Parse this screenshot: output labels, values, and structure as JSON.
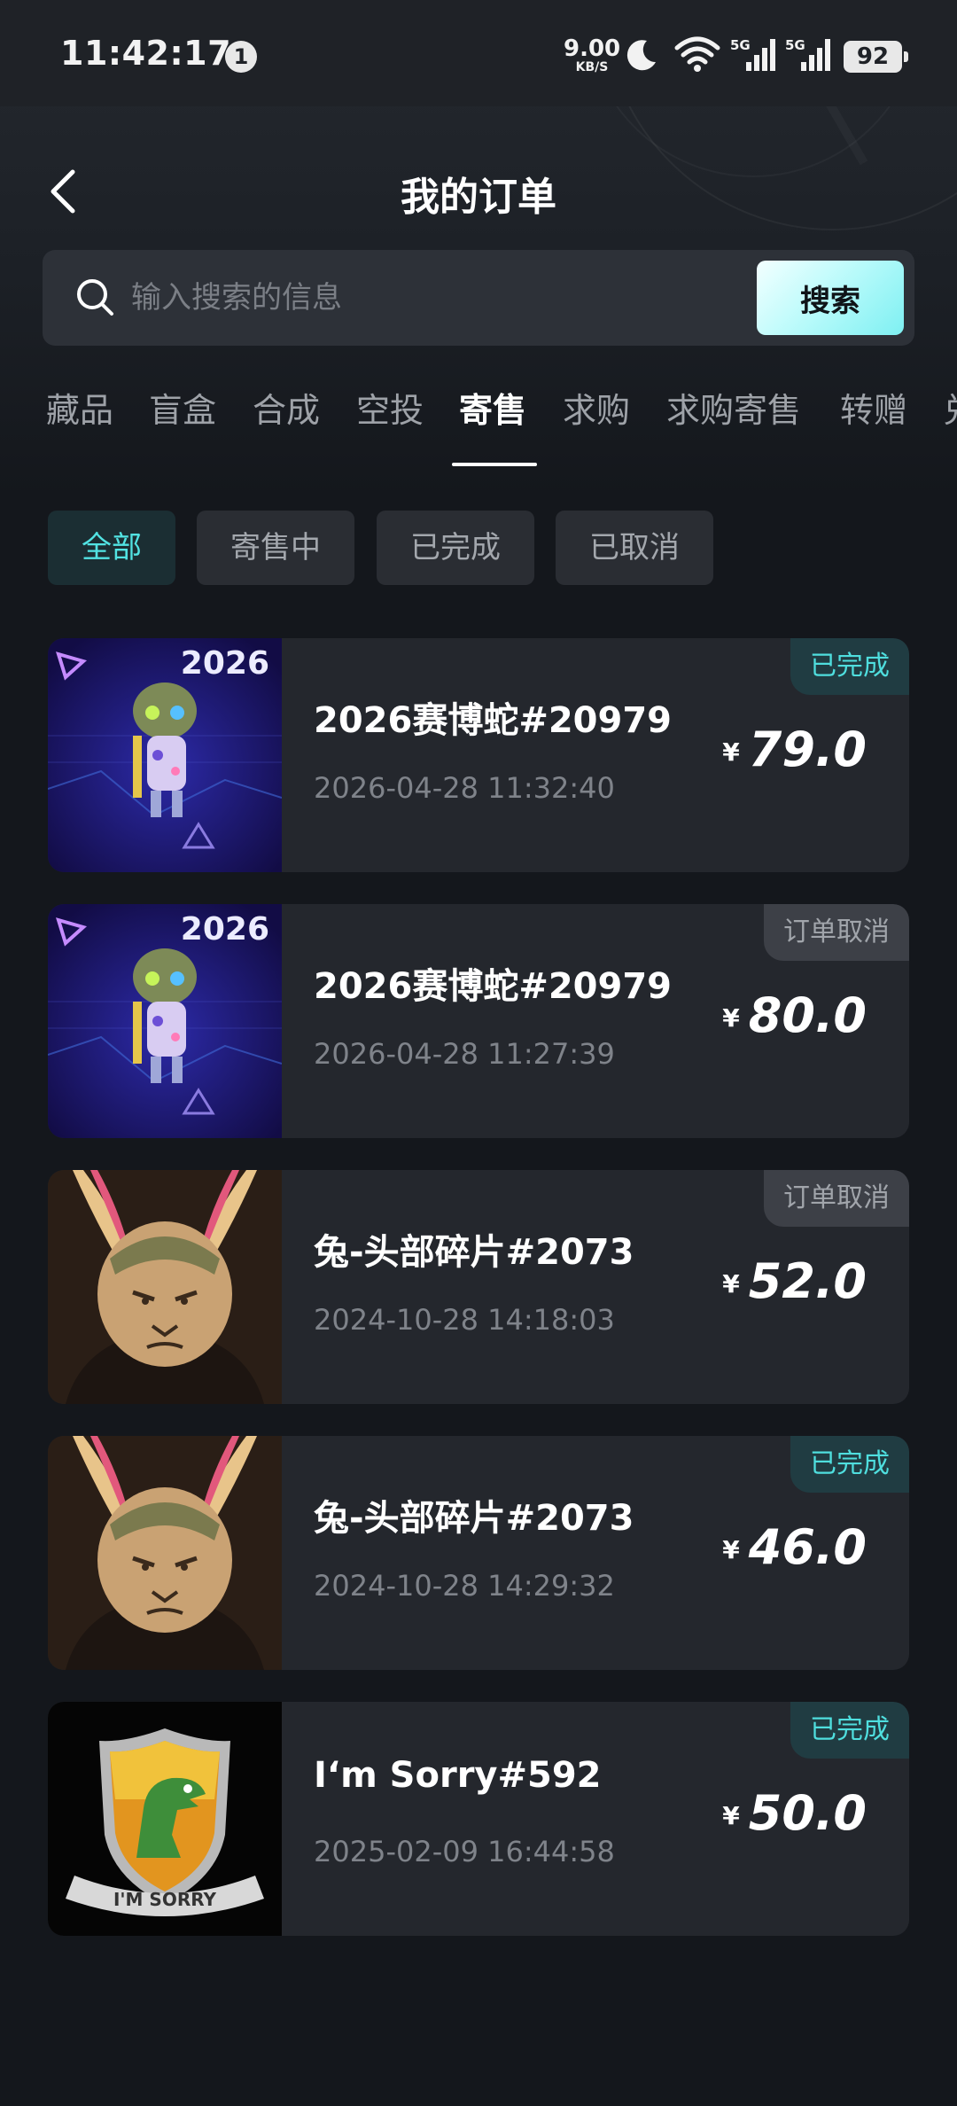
{
  "status_bar": {
    "time": "11:42:17",
    "notification_count": "1",
    "net_speed_value": "9.00",
    "net_speed_unit": "KB/S",
    "battery": "92"
  },
  "header": {
    "title": "我的订单"
  },
  "search": {
    "placeholder": "输入搜索的信息",
    "button_label": "搜索"
  },
  "tabs": [
    {
      "label": "藏品"
    },
    {
      "label": "盲盒"
    },
    {
      "label": "合成"
    },
    {
      "label": "空投"
    },
    {
      "label": "寄售",
      "active": true
    },
    {
      "label": "求购"
    },
    {
      "label": "求购寄售"
    },
    {
      "label": "转赠"
    },
    {
      "label": "兑"
    }
  ],
  "filters": [
    {
      "label": "全部",
      "active": true
    },
    {
      "label": "寄售中"
    },
    {
      "label": "已完成"
    },
    {
      "label": "已取消"
    }
  ],
  "orders": [
    {
      "name": "2026赛博蛇#20979",
      "time": "2026-04-28 11:32:40",
      "currency": "¥",
      "price": "79.0",
      "status": "已完成",
      "status_type": "done",
      "thumb_label": "2026"
    },
    {
      "name": "2026赛博蛇#20979",
      "time": "2026-04-28 11:27:39",
      "currency": "¥",
      "price": "80.0",
      "status": "订单取消",
      "status_type": "cancel",
      "thumb_label": "2026"
    },
    {
      "name": "兔-头部碎片#2073",
      "time": "2024-10-28 14:18:03",
      "currency": "¥",
      "price": "52.0",
      "status": "订单取消",
      "status_type": "cancel"
    },
    {
      "name": "兔-头部碎片#2073",
      "time": "2024-10-28 14:29:32",
      "currency": "¥",
      "price": "46.0",
      "status": "已完成",
      "status_type": "done"
    },
    {
      "name": "I‘m Sorry#592",
      "time": "2025-02-09 16:44:58",
      "currency": "¥",
      "price": "50.0",
      "status": "已完成",
      "status_type": "done",
      "thumb_label": "I'M SORRY"
    }
  ],
  "colors": {
    "accent": "#52e3e3",
    "background": "#14171c",
    "card": "#24272d"
  }
}
